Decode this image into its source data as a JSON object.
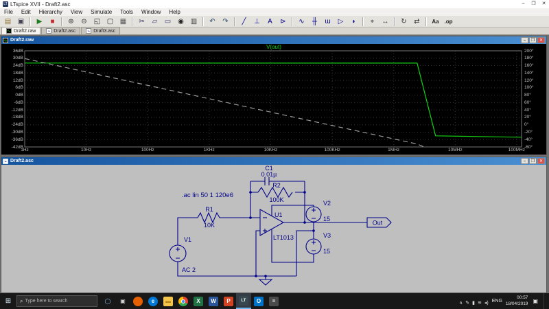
{
  "window": {
    "title": "LTspice XVII - Draft2.asc",
    "controls": {
      "minimize": "–",
      "maximize": "❐",
      "close": "✕"
    }
  },
  "menu": {
    "items": [
      "File",
      "Edit",
      "Hierarchy",
      "View",
      "Simulate",
      "Tools",
      "Window",
      "Help"
    ]
  },
  "toolbar": {
    "items": [
      {
        "name": "open",
        "glyph": "▤",
        "color": "#8a6d2f"
      },
      {
        "name": "save",
        "glyph": "▣",
        "color": "#445"
      },
      {
        "sep": true
      },
      {
        "name": "run",
        "glyph": "▶",
        "color": "#1d7a1d"
      },
      {
        "name": "halt",
        "glyph": "■",
        "color": "#c23030"
      },
      {
        "sep": true
      },
      {
        "name": "zoom-in",
        "glyph": "⊕",
        "color": "#333"
      },
      {
        "name": "zoom-out",
        "glyph": "⊖",
        "color": "#333"
      },
      {
        "name": "zoom-area",
        "glyph": "◱",
        "color": "#333"
      },
      {
        "name": "zoom-full-extents",
        "glyph": "▢",
        "color": "#333"
      },
      {
        "name": "grid",
        "glyph": "▦",
        "color": "#555"
      },
      {
        "sep": true
      },
      {
        "name": "cut",
        "glyph": "✂",
        "color": "#336"
      },
      {
        "name": "copy",
        "glyph": "▱",
        "color": "#336"
      },
      {
        "name": "paste",
        "glyph": "▭",
        "color": "#336"
      },
      {
        "name": "find",
        "glyph": "◉",
        "color": "#222"
      },
      {
        "name": "print",
        "glyph": "▥",
        "color": "#444"
      },
      {
        "sep": true
      },
      {
        "name": "undo",
        "glyph": "↶",
        "color": "#246"
      },
      {
        "name": "redo",
        "glyph": "↷",
        "color": "#246"
      },
      {
        "sep": true
      },
      {
        "name": "wire",
        "glyph": "╱",
        "color": "#00008b"
      },
      {
        "name": "ground",
        "glyph": "⊥",
        "color": "#00008b"
      },
      {
        "name": "label-net",
        "glyph": "A",
        "color": "#00008b"
      },
      {
        "name": "port",
        "glyph": "⊳",
        "color": "#00008b"
      },
      {
        "sep": true
      },
      {
        "name": "resistor",
        "glyph": "∿",
        "color": "#00008b"
      },
      {
        "name": "capacitor",
        "glyph": "╫",
        "color": "#00008b"
      },
      {
        "name": "inductor",
        "glyph": "ɯ",
        "color": "#00008b"
      },
      {
        "name": "diode",
        "glyph": "▷",
        "color": "#00008b"
      },
      {
        "name": "component",
        "glyph": "◗",
        "color": "#00008b"
      },
      {
        "sep": true
      },
      {
        "name": "move",
        "glyph": "⌖",
        "color": "#333"
      },
      {
        "name": "drag",
        "glyph": "↔",
        "color": "#333"
      },
      {
        "sep": true
      },
      {
        "name": "rotate",
        "glyph": "↻",
        "color": "#333"
      },
      {
        "name": "mirror",
        "glyph": "⇄",
        "color": "#333"
      },
      {
        "sep": true
      },
      {
        "name": "text",
        "glyph": "Aa",
        "color": "#222",
        "small": true
      },
      {
        "name": "spice-directive",
        "glyph": ".op",
        "color": "#222",
        "small": true
      }
    ]
  },
  "tabs": [
    {
      "label": "Draft2.raw",
      "icon": "wave",
      "active": true
    },
    {
      "label": "Draft2.asc",
      "icon": "sch",
      "active": false
    },
    {
      "label": "Draft3.asc",
      "icon": "sch",
      "active": false
    }
  ],
  "wave_window": {
    "title": "Draft2.raw"
  },
  "chart_data": {
    "type": "line",
    "title": "V(out)",
    "x_scale": "log",
    "x_range": [
      1,
      120000000
    ],
    "x_ticks": [
      "1Hz",
      "10Hz",
      "100Hz",
      "1KHz",
      "10KHz",
      "100KHz",
      "1MHz",
      "10MHz",
      "100MHz"
    ],
    "y_left": {
      "unit": "dB",
      "range": [
        36,
        -42
      ],
      "ticks": [
        "36dB",
        "30dB",
        "24dB",
        "18dB",
        "12dB",
        "6dB",
        "0dB",
        "-6dB",
        "-12dB",
        "-18dB",
        "-24dB",
        "-30dB",
        "-36dB",
        "-42dB"
      ]
    },
    "y_right": {
      "unit": "degrees",
      "range": [
        200,
        -60
      ],
      "ticks": [
        "200°",
        "180°",
        "160°",
        "140°",
        "120°",
        "100°",
        "80°",
        "60°",
        "40°",
        "20°",
        "0°",
        "-20°",
        "-40°",
        "-60°"
      ]
    },
    "grid": true,
    "series": [
      {
        "name": "vout-magnitude",
        "axis": "left",
        "style": "solid",
        "color": "#12d412",
        "points": [
          [
            1,
            26.1
          ],
          [
            2400000,
            26.0
          ],
          [
            4800000,
            -33.0
          ],
          [
            12000000,
            -33.3
          ],
          [
            48000000,
            -33.8
          ],
          [
            120000000,
            -34.1
          ]
        ]
      },
      {
        "name": "vout-phase",
        "axis": "right",
        "style": "dash",
        "color": "#9c9c9c",
        "points": [
          [
            1,
            179
          ],
          [
            2400000,
            -52
          ],
          [
            4800000,
            -73
          ],
          [
            120000000,
            -90
          ]
        ]
      }
    ]
  },
  "schematic_window": {
    "title": "Draft2.asc",
    "directive": ".ac lin 50 1 120e6",
    "out_label": "Out",
    "components": [
      {
        "ref": "C1",
        "value": "0.01µ"
      },
      {
        "ref": "R2",
        "value": "100K"
      },
      {
        "ref": "R1",
        "value": "10K"
      },
      {
        "ref": "U1",
        "value": "LT1013"
      },
      {
        "ref": "V2",
        "value": "15"
      },
      {
        "ref": "V3",
        "value": "15"
      },
      {
        "ref": "V1",
        "value": "AC 2"
      }
    ]
  },
  "taskbar": {
    "search_placeholder": "Type here to search",
    "apps": [
      {
        "name": "cortana",
        "glyph": "◯",
        "bg": "transparent",
        "fg": "#9ad1ff",
        "round": true
      },
      {
        "name": "task-view",
        "glyph": "▣",
        "bg": "transparent",
        "fg": "#d8d8d8"
      },
      {
        "name": "firefox",
        "glyph": "",
        "bg": "#e66000",
        "fg": "#fff",
        "round": true
      },
      {
        "name": "edge",
        "glyph": "e",
        "bg": "#0078d7",
        "fg": "#fff",
        "round": true
      },
      {
        "name": "file-explorer",
        "glyph": "▬",
        "bg": "#f3c64b",
        "fg": "#b5871c"
      },
      {
        "name": "chrome",
        "glyph": "",
        "bg": "",
        "fg": "",
        "chrome": true
      },
      {
        "name": "excel",
        "glyph": "X",
        "bg": "#217346",
        "fg": "#fff"
      },
      {
        "name": "word",
        "glyph": "W",
        "bg": "#2b579a",
        "fg": "#fff"
      },
      {
        "name": "powerpoint",
        "glyph": "P",
        "bg": "#d04423",
        "fg": "#fff"
      },
      {
        "name": "ltspice",
        "glyph": "LT",
        "bg": "#37474f",
        "fg": "#fff",
        "active": true
      },
      {
        "name": "outlook",
        "glyph": "O",
        "bg": "#0072c6",
        "fg": "#fff"
      },
      {
        "name": "calculator",
        "glyph": "=",
        "bg": "#4a4a4a",
        "fg": "#fff"
      }
    ],
    "tray": {
      "icons": [
        {
          "name": "hidden-icons",
          "glyph": "∧"
        },
        {
          "name": "pen",
          "glyph": "✎"
        },
        {
          "name": "battery",
          "glyph": "▮"
        },
        {
          "name": "network",
          "glyph": "≋"
        },
        {
          "name": "volume",
          "glyph": "◂)"
        }
      ],
      "language": "ENG",
      "time": "00:57",
      "date": "18/04/2019"
    }
  }
}
